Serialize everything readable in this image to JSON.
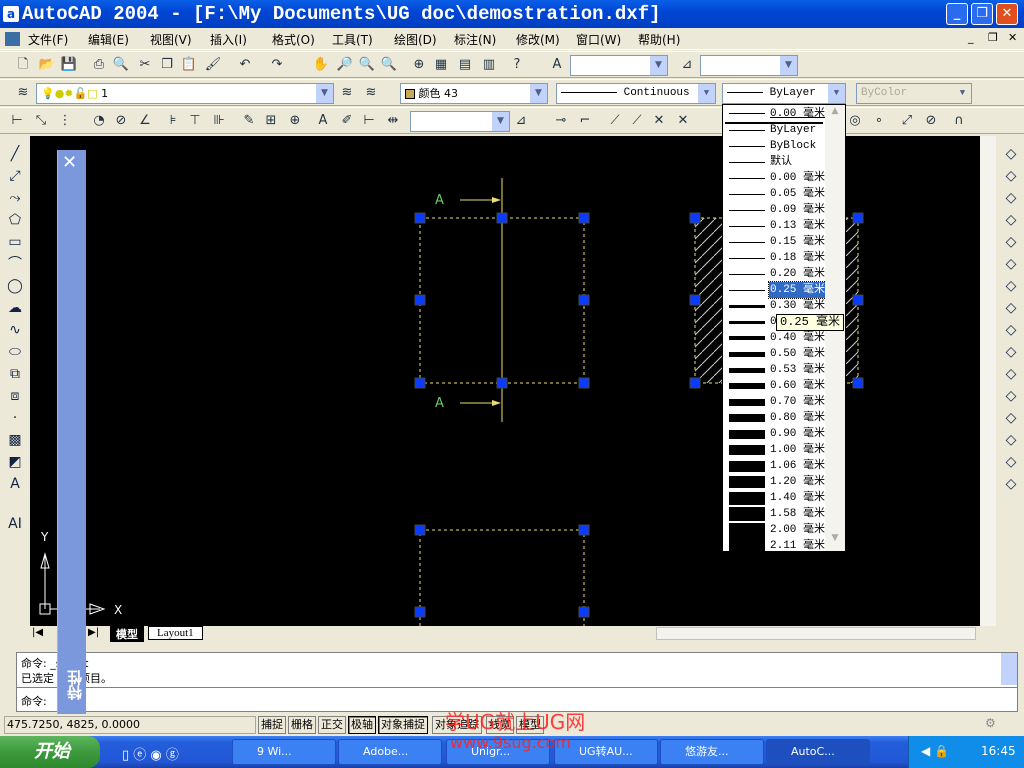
{
  "window": {
    "title": "AutoCAD 2004 - [F:\\My Documents\\UG doc\\demostration.dxf]",
    "minimize": "_",
    "restore": "❐",
    "close": "✕"
  },
  "menu": [
    "文件(F)",
    "编辑(E)",
    "视图(V)",
    "插入(I)",
    "格式(O)",
    "工具(T)",
    "绘图(D)",
    "标注(N)",
    "修改(M)",
    "窗口(W)",
    "帮助(H)"
  ],
  "layer_combo": {
    "value": "1"
  },
  "color_combo": {
    "value": "颜色 43",
    "swatch": "#c8a85a"
  },
  "linetype_combo": {
    "value": "Continuous"
  },
  "lineweight_combo": {
    "value": "ByLayer"
  },
  "plotstyle_combo": {
    "value": "ByColor"
  },
  "lineweight_dropdown": {
    "current": "0.00 毫米",
    "items": [
      {
        "label": "ByLayer",
        "w": 1
      },
      {
        "label": "ByBlock",
        "w": 1
      },
      {
        "label": "默认",
        "w": 1
      },
      {
        "label": "0.00 毫米",
        "w": 1
      },
      {
        "label": "0.05 毫米",
        "w": 1
      },
      {
        "label": "0.09 毫米",
        "w": 1
      },
      {
        "label": "0.13 毫米",
        "w": 1
      },
      {
        "label": "0.15 毫米",
        "w": 1
      },
      {
        "label": "0.18 毫米",
        "w": 1
      },
      {
        "label": "0.20 毫米",
        "w": 1
      },
      {
        "label": "0.25 毫米",
        "w": 1,
        "selected": true
      },
      {
        "label": "0.30 毫米",
        "w": 3
      },
      {
        "label": "0.35 毫米",
        "w": 3
      },
      {
        "label": "0.40 毫米",
        "w": 4
      },
      {
        "label": "0.50 毫米",
        "w": 5
      },
      {
        "label": "0.53 毫米",
        "w": 5
      },
      {
        "label": "0.60 毫米",
        "w": 6
      },
      {
        "label": "0.70 毫米",
        "w": 7
      },
      {
        "label": "0.80 毫米",
        "w": 8
      },
      {
        "label": "0.90 毫米",
        "w": 9
      },
      {
        "label": "1.00 毫米",
        "w": 10
      },
      {
        "label": "1.06 毫米",
        "w": 11
      },
      {
        "label": "1.20 毫米",
        "w": 12
      },
      {
        "label": "1.40 毫米",
        "w": 13
      },
      {
        "label": "1.58 毫米",
        "w": 14
      },
      {
        "label": "2.00 毫米",
        "w": 15
      },
      {
        "label": "2.11 毫米",
        "w": 16
      }
    ],
    "tooltip": "0.25 毫米"
  },
  "drawing": {
    "section_label_top": "A",
    "section_label_bottom": "A",
    "grip_color": "#0a3cff",
    "line_color": "#e8e070",
    "axis_x": "X",
    "axis_y": "Y"
  },
  "layout_tabs": [
    "模型",
    "Layout1"
  ],
  "properties_panel": {
    "title": "特性",
    "close": "✕"
  },
  "command": {
    "lines": [
      "命令: _select",
      "已选定 1 个项目。"
    ],
    "prompt": "命令:"
  },
  "status": {
    "coords": "475.7250, 4825, 0.0000",
    "toggles": [
      {
        "label": "捕捉",
        "on": false
      },
      {
        "label": "栅格",
        "on": false
      },
      {
        "label": "正交",
        "on": false
      },
      {
        "label": "极轴",
        "on": true
      },
      {
        "label": "对象捕捉",
        "on": true
      },
      {
        "label": "对象追踪",
        "on": false
      },
      {
        "label": "线宽",
        "on": false
      },
      {
        "label": "模型",
        "on": false
      }
    ]
  },
  "taskbar": {
    "start": "开始",
    "tasks": [
      {
        "label": "9 Wi...",
        "active": false
      },
      {
        "label": "Adobe...",
        "active": false
      },
      {
        "label": "Unigr...",
        "active": false
      },
      {
        "label": "UG转AU...",
        "active": false
      },
      {
        "label": "悠游友...",
        "active": false
      },
      {
        "label": "AutoC...",
        "active": true
      }
    ],
    "clock": "16:45"
  },
  "watermark": {
    "line1": "学UG就上UG网",
    "line2": "www.9sug.com"
  }
}
